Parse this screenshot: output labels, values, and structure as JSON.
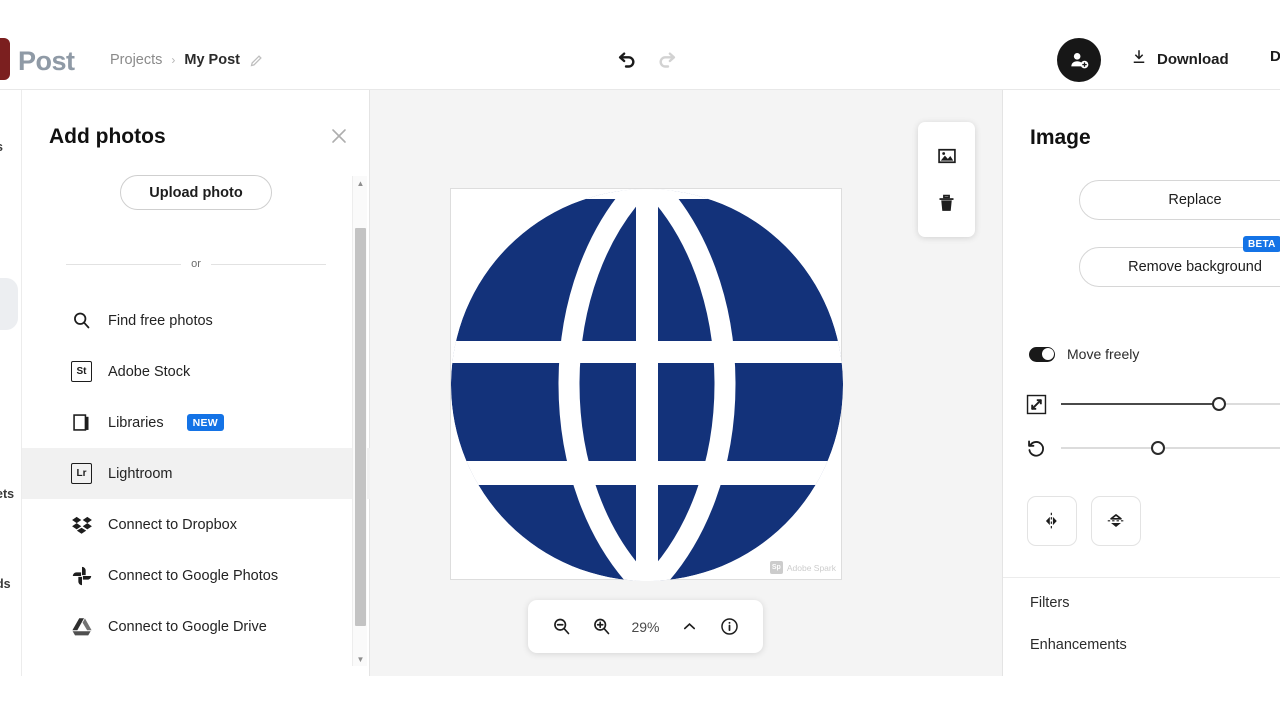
{
  "app": {
    "logo_text": "Post",
    "breadcrumb": {
      "parent": "Projects",
      "separator": "›",
      "current": "My Post",
      "edit_icon": "pencil-icon"
    },
    "undo_icon": "undo-arrow-icon",
    "redo_icon": "redo-arrow-icon",
    "avatar_icon": "add-collaborator-avatar-icon",
    "download_label": "Download",
    "download_icon": "download-arrow-icon",
    "cut_off_right_label": "D"
  },
  "left_rail": {
    "labels": [
      "s",
      "ets",
      "ds"
    ]
  },
  "add_photos_panel": {
    "title": "Add photos",
    "close_icon": "close-icon",
    "upload_label": "Upload photo",
    "or_label": "or",
    "sources": [
      {
        "label": "Find free photos",
        "icon": "search-icon",
        "badge": "",
        "active": false
      },
      {
        "label": "Adobe Stock",
        "icon": "adobe-stock-icon",
        "badge": "",
        "active": false
      },
      {
        "label": "Libraries",
        "icon": "libraries-icon",
        "badge": "NEW",
        "active": false
      },
      {
        "label": "Lightroom",
        "icon": "lightroom-icon",
        "badge": "",
        "active": true
      },
      {
        "label": "Connect to Dropbox",
        "icon": "dropbox-icon",
        "badge": "",
        "active": false
      },
      {
        "label": "Connect to Google Photos",
        "icon": "google-photos-icon",
        "badge": "",
        "active": false
      },
      {
        "label": "Connect to Google Drive",
        "icon": "google-drive-icon",
        "badge": "",
        "active": false
      }
    ],
    "scrollbar": {
      "up_icon": "scroll-up-arrow-icon",
      "down_icon": "scroll-down-arrow-icon"
    }
  },
  "canvas": {
    "artboard_bg": "#ffffff",
    "globe_color": "#13327a",
    "watermark": {
      "mark": "Sp",
      "text": "Adobe Spark"
    },
    "float_tools": [
      {
        "icon": "image-replace-icon"
      },
      {
        "icon": "trash-delete-icon"
      }
    ],
    "zoombar": {
      "zoom_out_icon": "zoom-out-icon",
      "zoom_in_icon": "zoom-in-icon",
      "zoom_level": "29%",
      "chevron_icon": "chevron-up-icon",
      "info_icon": "info-icon"
    }
  },
  "image_panel": {
    "title": "Image",
    "replace_label": "Replace",
    "remove_bg_label": "Remove background",
    "beta_badge": "BETA",
    "move_freely_label": "Move freely",
    "move_freely_on": true,
    "sliders": [
      {
        "icon": "resize-scale-icon",
        "value": 72
      },
      {
        "icon": "rotate-icon",
        "value": 44
      }
    ],
    "flip_buttons": [
      {
        "icon": "flip-horizontal-icon"
      },
      {
        "icon": "flip-vertical-icon"
      }
    ],
    "sections": [
      {
        "label": "Filters"
      },
      {
        "label": "Enhancements"
      }
    ]
  },
  "colors": {
    "accent_blue": "#1473e6",
    "globe_navy": "#13327a",
    "canvas_bg": "#f4f4f4",
    "logo_maroon": "#7b1f1f"
  }
}
